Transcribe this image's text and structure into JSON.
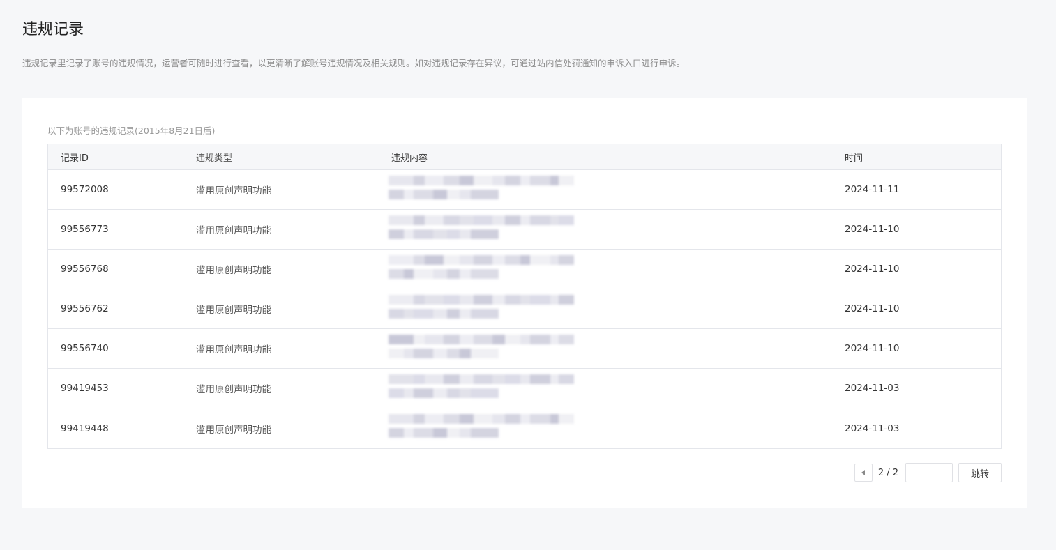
{
  "page": {
    "title": "违规记录",
    "description": "违规记录里记录了账号的违规情况，运营者可随时进行查看，以更清晰了解账号违规情况及相关规则。如对违规记录存在异议，可通过站内信处罚通知的申诉入口进行申诉。"
  },
  "card": {
    "caption": "以下为账号的违规记录(2015年8月21日后)"
  },
  "table": {
    "headers": {
      "id": "记录ID",
      "type": "违规类型",
      "content": "违规内容",
      "time": "时间"
    },
    "rows": [
      {
        "id": "99572008",
        "type": "滥用原创声明功能",
        "time": "2024-11-11"
      },
      {
        "id": "99556773",
        "type": "滥用原创声明功能",
        "time": "2024-11-10"
      },
      {
        "id": "99556768",
        "type": "滥用原创声明功能",
        "time": "2024-11-10"
      },
      {
        "id": "99556762",
        "type": "滥用原创声明功能",
        "time": "2024-11-10"
      },
      {
        "id": "99556740",
        "type": "滥用原创声明功能",
        "time": "2024-11-10"
      },
      {
        "id": "99419453",
        "type": "滥用原创声明功能",
        "time": "2024-11-03"
      },
      {
        "id": "99419448",
        "type": "滥用原创声明功能",
        "time": "2024-11-03"
      }
    ]
  },
  "pager": {
    "prev_icon": "chevron-left-icon",
    "page_text": "2 / 2",
    "input_value": "",
    "jump_label": "跳转"
  },
  "colors": {
    "background": "#f6f7f9",
    "card": "#ffffff",
    "border": "#e4e6eb",
    "header_bg": "#f6f7f9"
  }
}
